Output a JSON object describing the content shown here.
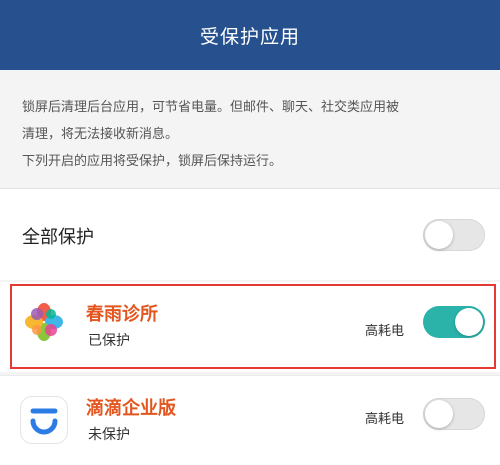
{
  "header": {
    "title": "受保护应用"
  },
  "description": {
    "lines": [
      "锁屏后清理后台应用，可节省电量。但邮件、聊天、社交类应用被",
      "清理，将无法接收新消息。",
      "下列开启的应用将受保护，锁屏后保持运行。"
    ]
  },
  "all_protect": {
    "label": "全部保护",
    "enabled": false
  },
  "apps": [
    {
      "name": "春雨诊所",
      "status": "已保护",
      "tag": "高耗电",
      "enabled": true,
      "icon": "chunyu-petal-icon"
    },
    {
      "name": "滴滴企业版",
      "status": "未保护",
      "tag": "高耗电",
      "enabled": false,
      "icon": "didi-logo-icon"
    }
  ],
  "colors": {
    "header_bg": "#26518e",
    "accent_text": "#e3561f",
    "toggle_on": "#2bb3aa",
    "highlight_border": "#e53935",
    "didi_blue": "#2d7be5"
  }
}
